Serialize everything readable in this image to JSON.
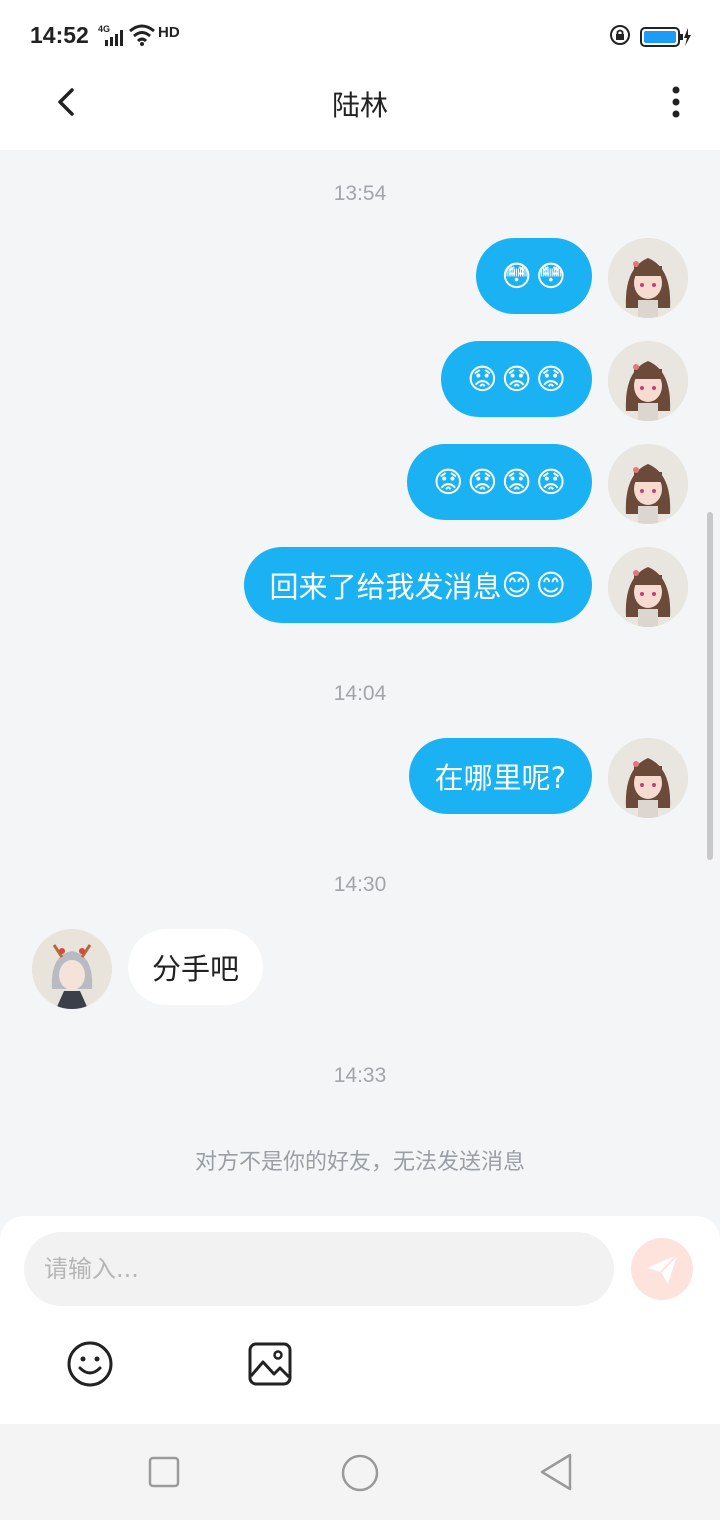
{
  "status_bar": {
    "time": "14:52",
    "network": "4G",
    "hd": "HD",
    "icons": [
      "signal-icon",
      "wifi-icon",
      "hd-icon",
      "orientation-lock-icon",
      "battery-charging-icon"
    ]
  },
  "header": {
    "title": "陆林",
    "back_icon": "chevron-left-icon",
    "more_icon": "more-vertical-icon"
  },
  "messages": [
    {
      "type": "timestamp",
      "text": "13:54"
    },
    {
      "type": "outgoing",
      "emoji": [
        "😳",
        "😳"
      ]
    },
    {
      "type": "outgoing",
      "emoji": [
        "😟",
        "😟",
        "😟"
      ]
    },
    {
      "type": "outgoing",
      "emoji": [
        "😟",
        "😟",
        "😟",
        "😟"
      ]
    },
    {
      "type": "outgoing",
      "text": "回来了给我发消息",
      "emoji": [
        "😊",
        "😊"
      ]
    },
    {
      "type": "timestamp",
      "text": "14:04"
    },
    {
      "type": "outgoing",
      "text": "在哪里呢?"
    },
    {
      "type": "timestamp",
      "text": "14:30"
    },
    {
      "type": "incoming",
      "text": "分手吧"
    },
    {
      "type": "timestamp",
      "text": "14:33"
    },
    {
      "type": "system",
      "text": "对方不是你的好友，无法发送消息"
    }
  ],
  "composer": {
    "placeholder": "请输入...",
    "send_icon": "send-icon",
    "tools": [
      "emoji-icon",
      "image-icon"
    ]
  },
  "nav_bar": {
    "icons": [
      "recent-apps-icon",
      "home-icon",
      "back-icon"
    ]
  },
  "colors": {
    "bubble_out": "#1bb2f4",
    "bubble_in": "#ffffff",
    "background": "#f3f5f6",
    "timestamp": "#a2a6ab",
    "send_button": "#fde3dc"
  }
}
